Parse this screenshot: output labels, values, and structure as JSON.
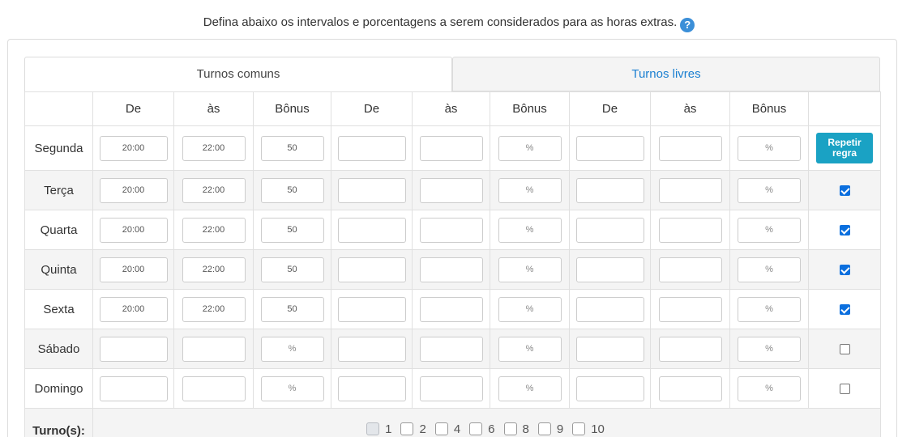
{
  "intro": {
    "text": "Defina abaixo os intervalos e porcentagens a serem considerados para as horas extras.",
    "help_icon": "?"
  },
  "tabs": [
    {
      "label": "Turnos comuns",
      "active": true
    },
    {
      "label": "Turnos livres",
      "active": false
    }
  ],
  "headers": [
    "",
    "De",
    "às",
    "Bônus",
    "De",
    "às",
    "Bônus",
    "De",
    "às",
    "Bônus",
    ""
  ],
  "percent_placeholder": "%",
  "repeat_button": "Repetir regra",
  "rows": [
    {
      "day": "Segunda",
      "values": [
        "20:00",
        "22:00",
        "50",
        "",
        "",
        "",
        "",
        "",
        ""
      ],
      "checked": null
    },
    {
      "day": "Terça",
      "values": [
        "20:00",
        "22:00",
        "50",
        "",
        "",
        "",
        "",
        "",
        ""
      ],
      "checked": true
    },
    {
      "day": "Quarta",
      "values": [
        "20:00",
        "22:00",
        "50",
        "",
        "",
        "",
        "",
        "",
        ""
      ],
      "checked": true
    },
    {
      "day": "Quinta",
      "values": [
        "20:00",
        "22:00",
        "50",
        "",
        "",
        "",
        "",
        "",
        ""
      ],
      "checked": true
    },
    {
      "day": "Sexta",
      "values": [
        "20:00",
        "22:00",
        "50",
        "",
        "",
        "",
        "",
        "",
        ""
      ],
      "checked": true
    },
    {
      "day": "Sábado",
      "values": [
        "",
        "",
        "",
        "",
        "",
        "",
        "",
        "",
        ""
      ],
      "checked": false
    },
    {
      "day": "Domingo",
      "values": [
        "",
        "",
        "",
        "",
        "",
        "",
        "",
        "",
        ""
      ],
      "checked": false
    }
  ],
  "turnos": {
    "label": "Turno(s):",
    "options": [
      {
        "label": "1",
        "disabled": true
      },
      {
        "label": "2",
        "disabled": false
      },
      {
        "label": "4",
        "disabled": false
      },
      {
        "label": "6",
        "disabled": false
      },
      {
        "label": "8",
        "disabled": false
      },
      {
        "label": "9",
        "disabled": false
      },
      {
        "label": "10",
        "disabled": false
      }
    ]
  },
  "colors": {
    "accent": "#1a7fd1",
    "button": "#1aa2c4",
    "checkbox": "#0b6fde"
  }
}
